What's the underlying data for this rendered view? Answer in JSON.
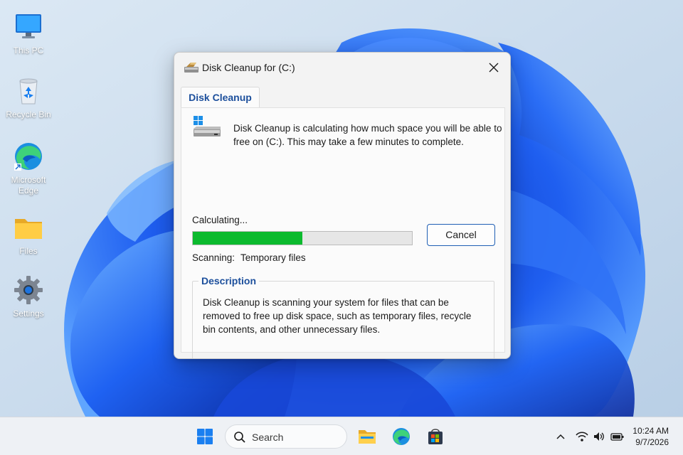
{
  "desktop": {
    "icons": [
      {
        "label": "This PC"
      },
      {
        "label": "Recycle Bin"
      },
      {
        "label": "Microsoft Edge"
      },
      {
        "label": "Files"
      },
      {
        "label": "Settings"
      }
    ]
  },
  "dialog": {
    "title": "Disk Cleanup for  (C:)",
    "tab_label": "Disk Cleanup",
    "intro_text": "Disk Cleanup is calculating how much space you will be able to free on  (C:). This may take a few minutes to complete.",
    "status_label": "Calculating...",
    "progress_fraction": 0.5,
    "cancel_label": "Cancel",
    "scanning_label": "Scanning:",
    "scanning_value": "Temporary files",
    "description_title": "Description",
    "description_text": "Disk Cleanup is scanning your system for files that can be removed to free up disk space, such as temporary files, recycle bin contents, and other unnecessary files.",
    "progress_color": "#0cba2e",
    "accent_color": "#1c4f9c"
  },
  "taskbar": {
    "search_placeholder": "Search",
    "pinned": [
      "windows-start-icon",
      "file-explorer-icon",
      "edge-icon",
      "store-icon"
    ],
    "tray_icons": [
      "chevron-up-icon",
      "wifi-icon",
      "volume-icon",
      "battery-icon"
    ],
    "time": "10:24 AM",
    "date": "9/7/2026"
  }
}
